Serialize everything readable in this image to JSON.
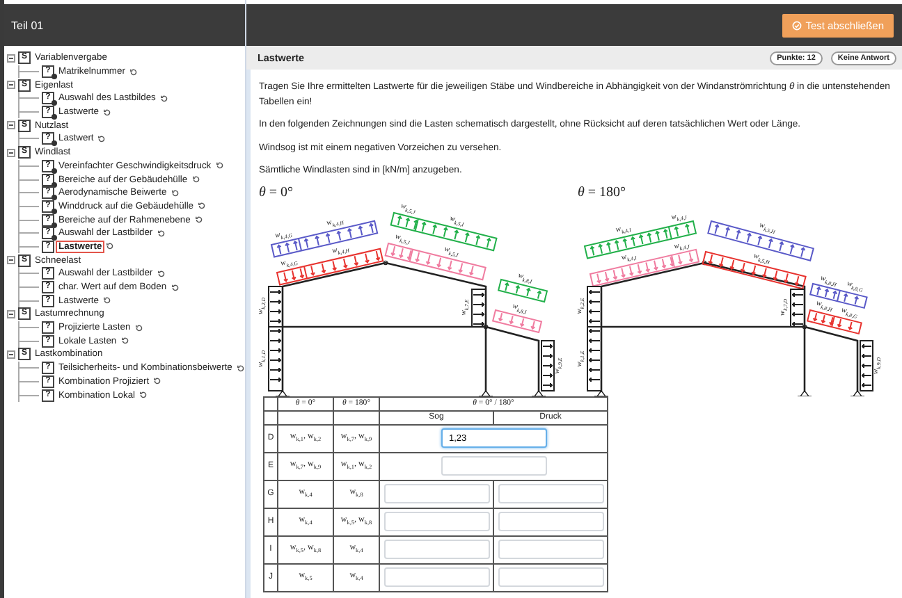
{
  "sidebar": {
    "title": "Teil 01",
    "tree": [
      {
        "kind": "section",
        "icon": "S",
        "label": "Variablenvergabe",
        "expanded": true,
        "children": [
          {
            "kind": "question",
            "icon": "?",
            "label": "Matrikelnummer",
            "answered": true,
            "selected": false
          }
        ]
      },
      {
        "kind": "section",
        "icon": "S",
        "label": "Eigenlast",
        "expanded": true,
        "children": [
          {
            "kind": "question",
            "icon": "?",
            "label": "Auswahl des Lastbildes",
            "answered": true,
            "selected": false
          },
          {
            "kind": "question",
            "icon": "?",
            "label": "Lastwerte",
            "answered": true,
            "selected": false
          }
        ]
      },
      {
        "kind": "section",
        "icon": "S",
        "label": "Nutzlast",
        "expanded": true,
        "children": [
          {
            "kind": "question",
            "icon": "?",
            "label": "Lastwert",
            "answered": true,
            "selected": false
          }
        ]
      },
      {
        "kind": "section",
        "icon": "S",
        "label": "Windlast",
        "expanded": true,
        "children": [
          {
            "kind": "question",
            "icon": "?",
            "label": "Vereinfachter Geschwindigkeitsdruck",
            "answered": true,
            "selected": false
          },
          {
            "kind": "question",
            "icon": "?",
            "label": "Bereiche auf der Gebäudehülle",
            "answered": true,
            "selected": false
          },
          {
            "kind": "question",
            "icon": "?",
            "label": "Aerodynamische Beiwerte",
            "answered": true,
            "selected": false
          },
          {
            "kind": "question",
            "icon": "?",
            "label": "Winddruck auf die Gebäudehülle",
            "answered": true,
            "selected": false
          },
          {
            "kind": "question",
            "icon": "?",
            "label": "Bereiche auf der Rahmenebene",
            "answered": true,
            "selected": false
          },
          {
            "kind": "question",
            "icon": "?",
            "label": "Auswahl der Lastbilder",
            "answered": true,
            "selected": false
          },
          {
            "kind": "question",
            "icon": "?",
            "label": "Lastwerte",
            "answered": false,
            "selected": true
          }
        ]
      },
      {
        "kind": "section",
        "icon": "S",
        "label": "Schneelast",
        "expanded": true,
        "children": [
          {
            "kind": "question",
            "icon": "?",
            "label": "Auswahl der Lastbilder",
            "answered": false,
            "selected": false
          },
          {
            "kind": "question",
            "icon": "?",
            "label": "char. Wert auf dem Boden",
            "answered": false,
            "selected": false
          },
          {
            "kind": "question",
            "icon": "?",
            "label": "Lastwerte",
            "answered": false,
            "selected": false
          }
        ]
      },
      {
        "kind": "section",
        "icon": "S",
        "label": "Lastumrechnung",
        "expanded": true,
        "children": [
          {
            "kind": "question",
            "icon": "?",
            "label": "Projizierte Lasten",
            "answered": false,
            "selected": false
          },
          {
            "kind": "question",
            "icon": "?",
            "label": "Lokale Lasten",
            "answered": false,
            "selected": false
          }
        ]
      },
      {
        "kind": "section",
        "icon": "S",
        "label": "Lastkombination",
        "expanded": true,
        "children": [
          {
            "kind": "question",
            "icon": "?",
            "label": "Teilsicherheits- und Kombinationsbeiwerte",
            "answered": false,
            "selected": false
          },
          {
            "kind": "question",
            "icon": "?",
            "label": "Kombination Projiziert",
            "answered": false,
            "selected": false
          },
          {
            "kind": "question",
            "icon": "?",
            "label": "Kombination Lokal",
            "answered": false,
            "selected": false
          }
        ]
      }
    ]
  },
  "toolbar": {
    "finish_button": "Test abschließen"
  },
  "question": {
    "title": "Lastwerte",
    "points": "Punkte: 12",
    "status": "Keine Antwort",
    "paragraphs": [
      "Tragen Sie Ihre ermittelten Lastwerte für die jeweiligen Stäbe und Windbereiche in Abhängigkeit von der Windanströmrichtung *θ* in die untenstehenden Tabellen ein!",
      "In den folgenden Zeichnungen sind die Lasten schematisch dargestellt, ohne Rücksicht auf deren tatsächlichen Wert oder Länge.",
      "Windsog ist mit einem negativen Vorzeichen zu versehen.",
      "Sämtliche Windlasten sind in [kN/m] anzugeben."
    ]
  },
  "diagrams": [
    {
      "heading": "*θ* = 0°",
      "loads": [
        {
          "color": "#5a5ac8",
          "labels": [
            "w$_{k,4,G}$",
            "w$_{k,4,H}$"
          ]
        },
        {
          "color": "#e8332f",
          "labels": [
            "w$_{k,4,G}$",
            "w$_{k,4,H}$"
          ]
        },
        {
          "color": "#22b04a",
          "labels": [
            "w$_{k,5,J}$",
            "w$_{k,5,I}$"
          ]
        },
        {
          "color": "#f07ca0",
          "labels": [
            "w$_{k,5,J}$",
            "w$_{k,5,I}$"
          ]
        },
        {
          "color": "#22b04a",
          "labels": [
            "w$_{k,8,I}$"
          ]
        },
        {
          "color": "#f07ca0",
          "labels": [
            "w$_{k,8,I}$"
          ]
        },
        {
          "color": "#222222",
          "labels": [
            "w$_{k,2,D}$",
            "w$_{k,1,D}$"
          ]
        },
        {
          "color": "#222222",
          "labels": [
            "w$_{k,7,E}$"
          ]
        },
        {
          "color": "#222222",
          "labels": [
            "w$_{k,9,E}$"
          ]
        }
      ]
    },
    {
      "heading": "*θ* = 180°",
      "loads": [
        {
          "color": "#22b04a",
          "labels": [
            "w$_{k,4,I}$",
            "w$_{k,4,J}$"
          ]
        },
        {
          "color": "#f07ca0",
          "labels": [
            "w$_{k,4,I}$",
            "w$_{k,4,J}$"
          ]
        },
        {
          "color": "#5a5ac8",
          "labels": [
            "w$_{k,5,H}$"
          ]
        },
        {
          "color": "#e8332f",
          "labels": [
            "w$_{k,5,H}$"
          ]
        },
        {
          "color": "#5a5ac8",
          "labels": [
            "w$_{k,8,H}$",
            "w$_{k,8,G}$"
          ]
        },
        {
          "color": "#e8332f",
          "labels": [
            "w$_{k,8,H}$",
            "w$_{k,8,G}$"
          ]
        },
        {
          "color": "#222222",
          "labels": [
            "w$_{k,2,E}$",
            "w$_{k,1,E}$"
          ]
        },
        {
          "color": "#222222",
          "labels": [
            "w$_{k,7,D}$"
          ]
        },
        {
          "color": "#222222",
          "labels": [
            "w$_{k,9,D}$"
          ]
        }
      ]
    }
  ],
  "table": {
    "headers": [
      "*θ* = 0°",
      "*θ* = 180°",
      "*θ* = 0° / 180°"
    ],
    "subheaders": [
      "Sog",
      "Druck"
    ],
    "rows": [
      {
        "letter": "D",
        "at_0": "w$_{k,1}$, w$_{k,2}$",
        "at_180": "w$_{k,7}$, w$_{k,9}$",
        "kind": "merged",
        "value": "1,23",
        "focused": true
      },
      {
        "letter": "E",
        "at_0": "w$_{k,7}$, w$_{k,9}$",
        "at_180": "w$_{k,1}$, w$_{k,2}$",
        "kind": "merged",
        "focused": false
      },
      {
        "letter": "G",
        "at_0": "w$_{k,4}$",
        "at_180": "w$_{k,8}$",
        "kind": "split"
      },
      {
        "letter": "H",
        "at_0": "w$_{k,4}$",
        "at_180": "w$_{k,5}$, w$_{k,8}$",
        "kind": "split"
      },
      {
        "letter": "I",
        "at_0": "w$_{k,5}$, w$_{k,8}$",
        "at_180": "w$_{k,4}$",
        "kind": "split"
      },
      {
        "letter": "J",
        "at_0": "w$_{k,5}$",
        "at_180": "w$_{k,4}$",
        "kind": "split"
      }
    ]
  }
}
